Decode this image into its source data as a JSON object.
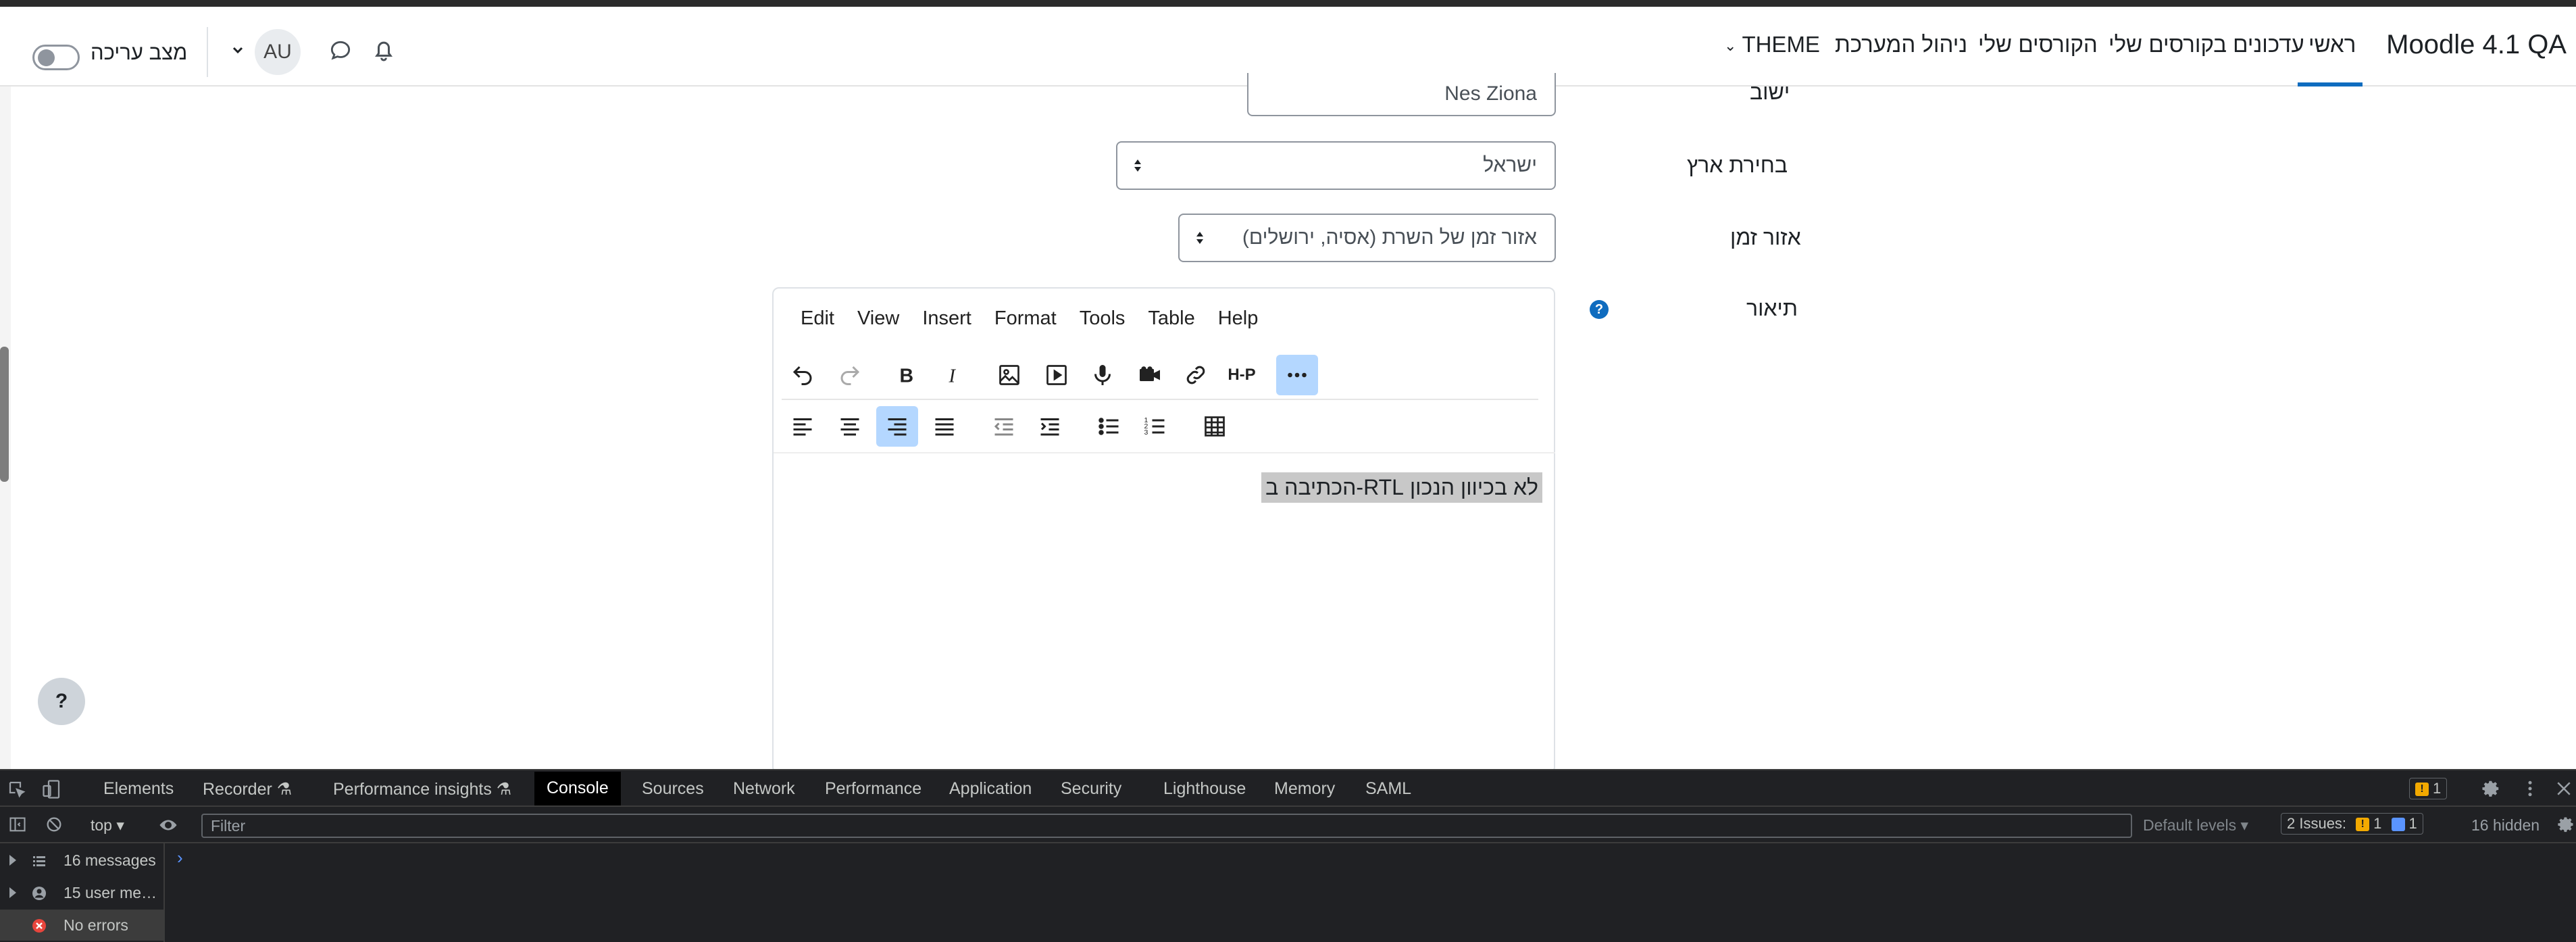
{
  "navbar": {
    "brand": "Moodle 4.1 QA",
    "items": [
      "ראשי",
      "עדכונים בקורסים שלי",
      "הקורסים שלי",
      "ניהול המערכת",
      "THEME"
    ],
    "active_item": "ראשי",
    "avatar_initials": "AU",
    "edit_mode_label": "מצב עריכה",
    "edit_mode_on": false
  },
  "form": {
    "city_label": "ישוב",
    "city_value": "Nes Ziona",
    "country_label": "בחירת ארץ",
    "country_value": "ישראל",
    "timezone_label": "אזור זמן",
    "timezone_value": "אזור זמן של השרת (אסיה, ירושלים)",
    "description_label": "תיאור"
  },
  "editor": {
    "menu": [
      "Edit",
      "View",
      "Insert",
      "Format",
      "Tools",
      "Table",
      "Help"
    ],
    "h5p_label": "H-P",
    "content": "לא בכיוון הנכון RTL-הכתיבה ב"
  },
  "help_button": "?",
  "devtools": {
    "tabs": [
      "Elements",
      "Recorder",
      "Performance insights",
      "Console",
      "Sources",
      "Network",
      "Performance",
      "Application",
      "Security",
      "Lighthouse",
      "Memory",
      "SAML"
    ],
    "active_tab": "Console",
    "warning_count": "1",
    "context": "top",
    "filter_placeholder": "Filter",
    "levels": "Default levels",
    "issues_label": "2 Issues:",
    "issues_warn": "1",
    "issues_info": "1",
    "hidden": "16 hidden",
    "sidebar": [
      {
        "label": "16 messages"
      },
      {
        "label": "15 user me…"
      },
      {
        "label": "No errors"
      }
    ]
  }
}
